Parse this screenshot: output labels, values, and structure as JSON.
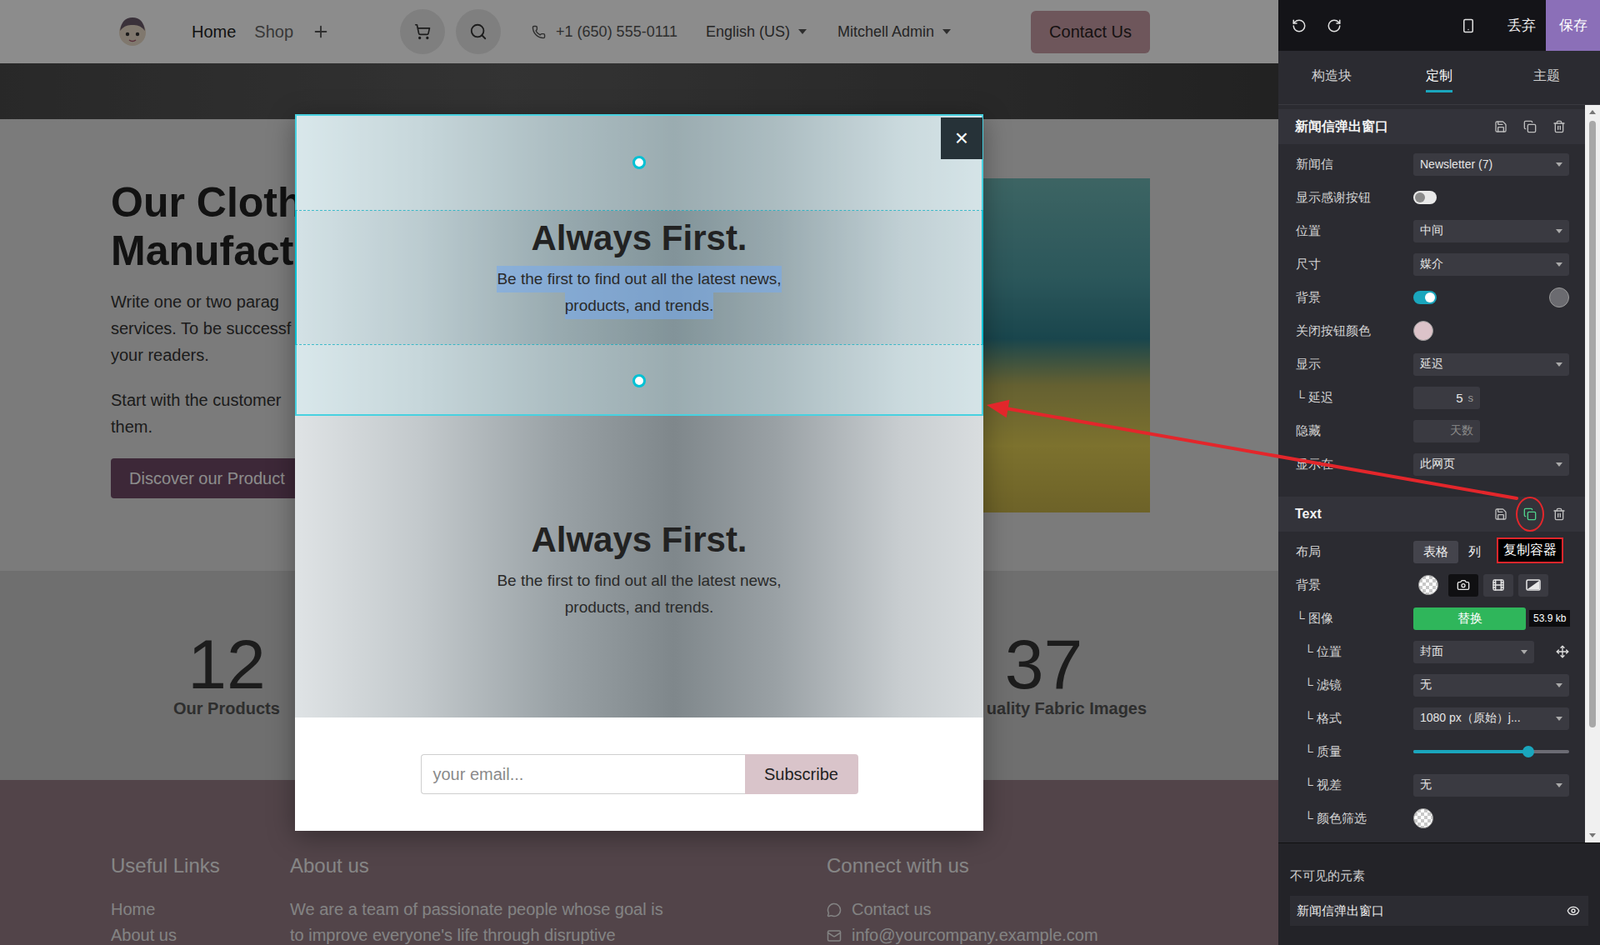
{
  "navbar": {
    "links": [
      {
        "label": "Home",
        "selected": true
      },
      {
        "label": "Shop",
        "selected": false
      }
    ],
    "phone": "+1 (650) 555-0111",
    "menus": [
      {
        "label": "English (US)"
      },
      {
        "label": "Mitchell Admin"
      }
    ],
    "cta": "Contact Us"
  },
  "hero": {
    "title_lines": [
      "Our Cloth",
      "Manufact"
    ],
    "paragraphs": [
      [
        "Write one or two parag",
        "services. To be successf",
        "your readers."
      ],
      [
        "Start with the customer",
        "them."
      ]
    ],
    "button": "Discover our Product"
  },
  "stats": [
    {
      "value": "12",
      "label": "Our Products"
    },
    {
      "value": "37",
      "label": "uality Fabric Images"
    }
  ],
  "footer": {
    "columns": [
      {
        "kind": "links",
        "title": "Useful Links",
        "lines": [
          "Home",
          "About us"
        ]
      },
      {
        "kind": "text",
        "title": "About us",
        "lines": [
          "We are a team of passionate people whose goal is",
          "to improve everyone's life through disruptive"
        ]
      },
      {
        "kind": "contact",
        "title": "Connect with us",
        "lines": [
          "Contact us",
          "info@yourcompany.example.com"
        ]
      }
    ]
  },
  "popup": {
    "close": "×",
    "blocks": [
      {
        "title": "Always First.",
        "lines": [
          "Be the first to find out all the latest news,",
          "products, and trends."
        ],
        "selected": true,
        "text_selected": true
      },
      {
        "title": "Always First.",
        "lines": [
          "Be the first to find out all the latest news,",
          "products, and trends."
        ],
        "selected": false,
        "text_selected": false
      }
    ],
    "email_placeholder": "your email...",
    "subscribe": "Subscribe"
  },
  "editor": {
    "toolbar": {
      "discard": "丢弃",
      "save": "保存"
    },
    "tabs": [
      {
        "label": "构造块",
        "selected": false
      },
      {
        "label": "定制",
        "selected": true
      },
      {
        "label": "主题",
        "selected": false
      }
    ],
    "sections": [
      {
        "title": "新闻信弹出窗口",
        "copy_highlighted": false,
        "tooltip": "",
        "rows": [
          {
            "kind": "select",
            "label": "新闻信",
            "nested": 0,
            "value": "Newsletter (7)"
          },
          {
            "kind": "toggle",
            "label": "显示感谢按钮",
            "nested": 0,
            "on": false
          },
          {
            "kind": "select",
            "label": "位置",
            "nested": 0,
            "value": "中间"
          },
          {
            "kind": "select",
            "label": "尺寸",
            "nested": 0,
            "value": "媒介"
          },
          {
            "kind": "toggle",
            "label": "背景",
            "nested": 0,
            "on": true,
            "swatch": "#6b6b70"
          },
          {
            "kind": "color",
            "label": "关闭按钮颜色",
            "nested": 0,
            "swatch": "#dcc3c9"
          },
          {
            "kind": "select",
            "label": "显示",
            "nested": 0,
            "value": "延迟"
          },
          {
            "kind": "number",
            "label": "└ 延迟",
            "nested": 1,
            "value": "5",
            "unit": "s"
          },
          {
            "kind": "input",
            "label": "隐藏",
            "nested": 0,
            "placeholder": "天数"
          },
          {
            "kind": "select",
            "label": "显示在",
            "nested": 0,
            "value": "此网页"
          }
        ]
      },
      {
        "title": "Text",
        "copy_highlighted": true,
        "tooltip": "复制容器",
        "rows": [
          {
            "kind": "segmented",
            "label": "布局",
            "nested": 0,
            "options": [
              {
                "label": "表格",
                "selected": true
              },
              {
                "label": "列",
                "selected": false
              }
            ]
          },
          {
            "kind": "background",
            "label": "背景",
            "nested": 0,
            "options": [
              {
                "kind": "color",
                "selected": false
              },
              {
                "kind": "image",
                "selected": true
              },
              {
                "kind": "video",
                "selected": false
              },
              {
                "kind": "gradient",
                "selected": false
              }
            ]
          },
          {
            "kind": "replace",
            "label": "└ 图像",
            "nested": 1,
            "button": "替换",
            "badge": "53.9 kb"
          },
          {
            "kind": "position",
            "label": "└ 位置",
            "nested": 2,
            "value": "封面"
          },
          {
            "kind": "select",
            "label": "└ 滤镜",
            "nested": 2,
            "value": "无"
          },
          {
            "kind": "select",
            "label": "└ 格式",
            "nested": 2,
            "value": "1080 px（原始）j..."
          },
          {
            "kind": "slider",
            "label": "└ 质量",
            "nested": 2,
            "level": 0.74
          },
          {
            "kind": "select",
            "label": "└ 视差",
            "nested": 2,
            "value": "无"
          },
          {
            "kind": "color",
            "label": "└ 颜色筛选",
            "nested": 2,
            "swatch": "transparent"
          }
        ]
      }
    ],
    "invisible": {
      "title": "不可见的元素",
      "items": [
        {
          "label": "新闻信弹出窗口",
          "visible": true
        }
      ]
    },
    "scrollbar": {
      "level": 0.86
    }
  }
}
